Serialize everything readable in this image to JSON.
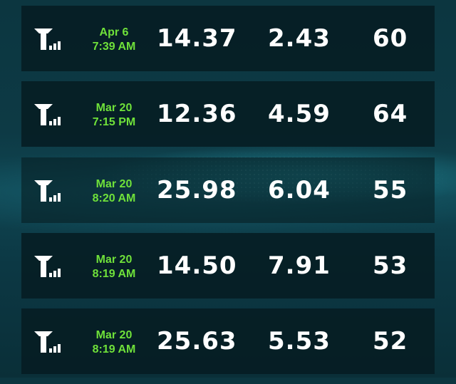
{
  "rows": [
    {
      "date": "Apr 6",
      "time": "7:39 AM",
      "download": "14.37",
      "upload": "2.43",
      "ping": "60",
      "icon": "cell-signal-icon"
    },
    {
      "date": "Mar 20",
      "time": "7:15 PM",
      "download": "12.36",
      "upload": "4.59",
      "ping": "64",
      "icon": "cell-signal-icon"
    },
    {
      "date": "Mar 20",
      "time": "8:20 AM",
      "download": "25.98",
      "upload": "6.04",
      "ping": "55",
      "icon": "cell-signal-icon"
    },
    {
      "date": "Mar 20",
      "time": "8:19 AM",
      "download": "14.50",
      "upload": "7.91",
      "ping": "53",
      "icon": "cell-signal-icon"
    },
    {
      "date": "Mar 20",
      "time": "8:19 AM",
      "download": "25.63",
      "upload": "5.53",
      "ping": "52",
      "icon": "cell-signal-icon"
    }
  ],
  "colors": {
    "timestamp": "#6fe13a",
    "value": "#ffffff",
    "row_bg": "#061c22"
  }
}
